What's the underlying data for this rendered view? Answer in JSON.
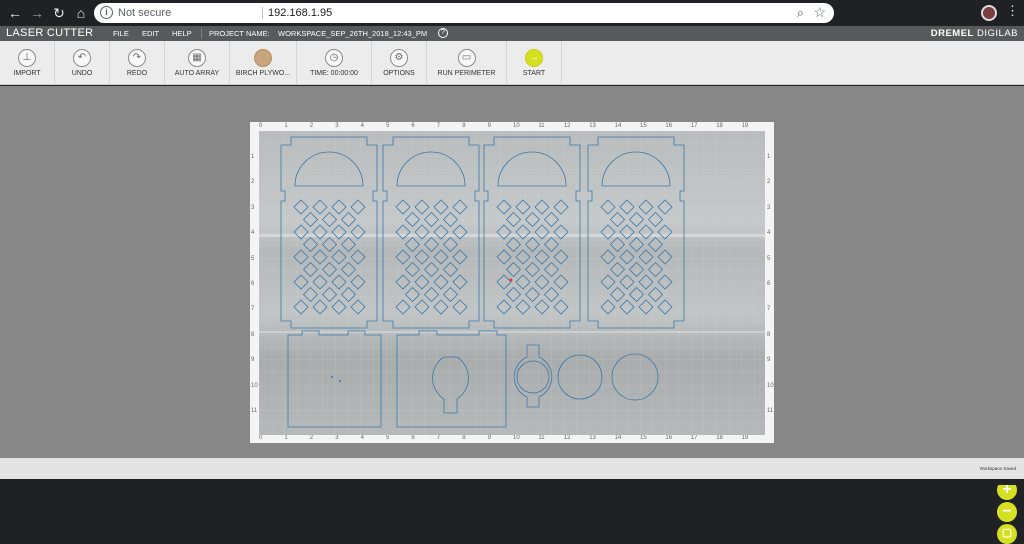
{
  "browser": {
    "security_label": "Not secure",
    "url": "192.168.1.95"
  },
  "app": {
    "title": "LASER CUTTER",
    "menus": [
      "FILE",
      "EDIT",
      "HELP"
    ],
    "project_label": "PROJECT NAME:",
    "project_name": "WORKSPACE_SEP_26TH_2018_12:43_PM",
    "brand_bold": "DREMEL",
    "brand_light": " DIGILAB"
  },
  "toolbar": {
    "items": [
      {
        "label": "IMPORT",
        "icon": "import-icon"
      },
      {
        "label": "UNDO",
        "icon": "undo-icon"
      },
      {
        "label": "REDO",
        "icon": "redo-icon"
      },
      {
        "label": "AUTO ARRAY",
        "icon": "grid-icon"
      },
      {
        "label": "BIRCH PLYWO...",
        "icon": "material-swatch-icon"
      },
      {
        "label": "TIME: 00:00:00",
        "icon": "clock-icon"
      },
      {
        "label": "OPTIONS",
        "icon": "gear-icon"
      },
      {
        "label": "RUN PERIMETER",
        "icon": "perimeter-icon"
      },
      {
        "label": "START",
        "icon": "start-arrow-icon"
      }
    ]
  },
  "bed": {
    "ruler_x": [
      "0",
      "1",
      "2",
      "3",
      "4",
      "5",
      "6",
      "7",
      "8",
      "9",
      "10",
      "11",
      "12",
      "13",
      "14",
      "15",
      "16",
      "17",
      "18",
      "19"
    ],
    "ruler_y": [
      "1",
      "2",
      "3",
      "4",
      "5",
      "6",
      "7",
      "8",
      "9",
      "10",
      "11"
    ]
  },
  "status": {
    "text": "Workspace Saved"
  },
  "colors": {
    "accent": "#d5e021",
    "cut_line": "#3c78a8",
    "app_bar": "#58595b"
  }
}
